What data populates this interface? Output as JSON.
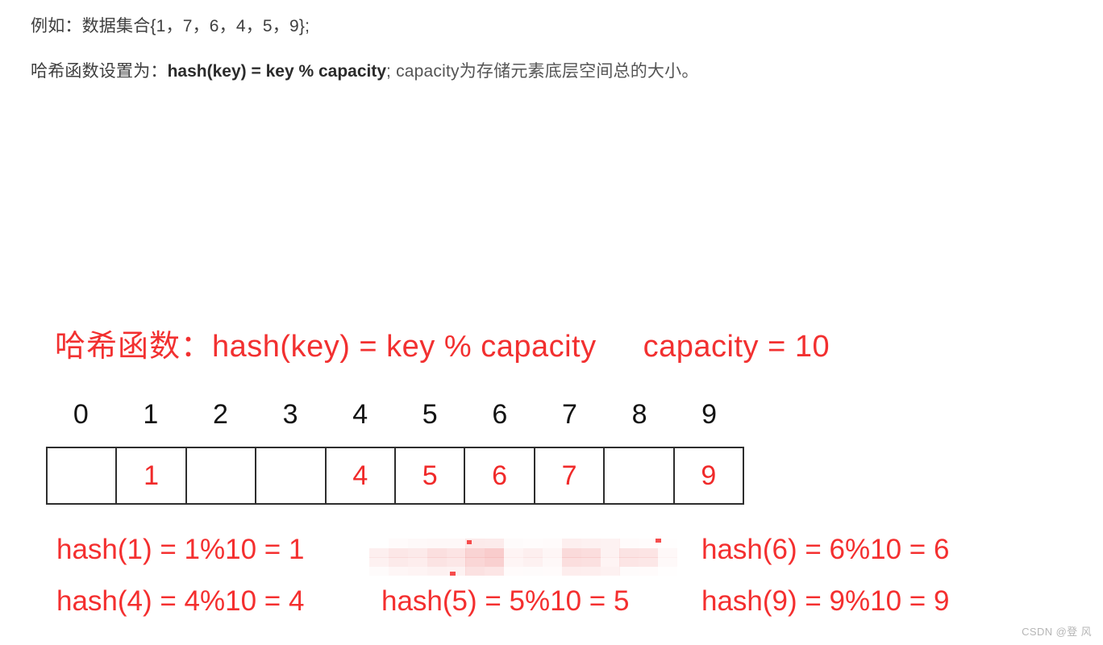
{
  "colors": {
    "accent_red": "#f42f2f",
    "cell_red": "#f02a2a",
    "heading_red": "#f23030",
    "text_dark": "#3f3f3f",
    "border": "#2e2e2e",
    "watermark": "#b6b6b6",
    "censor_pink": "#f6b8b8",
    "background": "#ffffff"
  },
  "prose": {
    "line1": "例如：数据集合{1，7，6，4，5，9};",
    "line2_prefix": "哈希函数设置为：",
    "line2_strong": "hash(key) = key % capacity",
    "line2_rest": "; capacity为存储元素底层空间总的大小。"
  },
  "diagram": {
    "heading_label": "哈希函数：",
    "heading_formula": "hash(key) = key % capacity",
    "heading_capacity": "capacity = 10",
    "capacity_value": 10,
    "index_labels": [
      "0",
      "1",
      "2",
      "3",
      "4",
      "5",
      "6",
      "7",
      "8",
      "9"
    ],
    "cells": [
      "",
      "1",
      "",
      "",
      "4",
      "5",
      "6",
      "7",
      "",
      "9"
    ],
    "dataset": [
      1,
      7,
      6,
      4,
      5,
      9
    ],
    "formulas": [
      [
        "hash(1) = 1%10 = 1",
        "",
        "hash(6) = 6%10 = 6"
      ],
      [
        "hash(4) = 4%10 = 4",
        "hash(5) = 5%10 = 5",
        "hash(9) = 9%10 = 9"
      ]
    ],
    "censored_formula_note": "hash(7) = 7%10 = 7"
  },
  "watermark": {
    "text": "CSDN @登 风"
  }
}
